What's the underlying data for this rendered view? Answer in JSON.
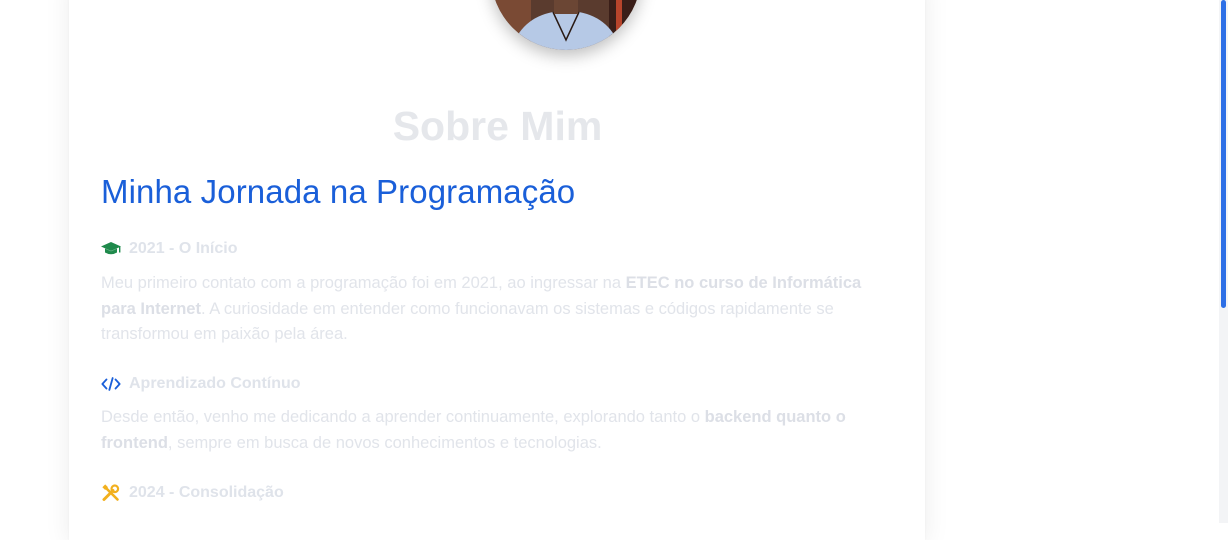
{
  "about": {
    "section_title": "Sobre Mim",
    "journey_title": "Minha Jornada na Programação",
    "items": [
      {
        "icon": "graduation-cap-icon",
        "icon_color": "#1f8a4c",
        "heading": "2021 - O Início",
        "text_parts": [
          "Meu primeiro contato com a programação foi em 2021, ao ingressar na ",
          "ETEC no curso de Informática para Internet",
          ". A curiosidade em entender como funcionavam os sistemas e códigos rapidamente se transformou em paixão pela área."
        ]
      },
      {
        "icon": "code-icon",
        "icon_color": "#1a5fd9",
        "heading": "Aprendizado Contínuo",
        "text_parts": [
          "Desde então, venho me dedicando a aprender continuamente, explorando tanto o ",
          "backend quanto o frontend",
          ", sempre em busca de novos conhecimentos e tecnologias."
        ]
      },
      {
        "icon": "tools-icon",
        "icon_color": "#f2b01e",
        "heading": "2024 - Consolidação"
      }
    ]
  },
  "colors": {
    "accent": "#1a5fd9",
    "scroll_thumb": "#2d6fe6"
  }
}
